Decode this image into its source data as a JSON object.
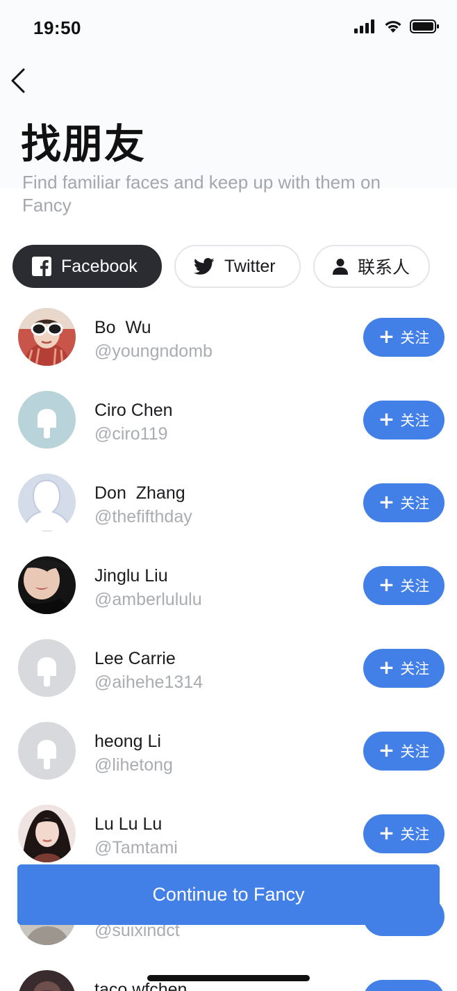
{
  "status_bar": {
    "time": "19:50"
  },
  "header": {
    "title": "找朋友",
    "subtitle": "Find familiar faces and keep up with them on Fancy"
  },
  "tabs": [
    {
      "label": "Facebook",
      "icon": "facebook-icon",
      "active": true
    },
    {
      "label": "Twitter",
      "icon": "twitter-icon",
      "active": false
    },
    {
      "label": "联系人",
      "icon": "person-icon",
      "active": false
    }
  ],
  "friends": [
    {
      "name": "Bo  Wu",
      "handle": "@youngndomb",
      "avatar": "photo",
      "follow_label": "关注"
    },
    {
      "name": "Ciro Chen",
      "handle": "@ciro119",
      "avatar": "popsicle-placeholder",
      "follow_label": "关注"
    },
    {
      "name": "Don  Zhang",
      "handle": "@thefifthday",
      "avatar": "silhouette",
      "follow_label": "关注"
    },
    {
      "name": "Jinglu Liu",
      "handle": "@amberlululu",
      "avatar": "photo",
      "follow_label": "关注"
    },
    {
      "name": "Lee Carrie",
      "handle": "@aihehe1314",
      "avatar": "popsicle-placeholder",
      "follow_label": "关注"
    },
    {
      "name": "heong Li",
      "handle": "@lihetong",
      "avatar": "popsicle-placeholder",
      "follow_label": "关注"
    },
    {
      "name": "Lu Lu Lu",
      "handle": "@Tamtami",
      "avatar": "photo",
      "follow_label": "关注"
    },
    {
      "name": "",
      "handle": "@suixindct",
      "avatar": "photo",
      "follow_label": ""
    },
    {
      "name": "taco wfchen",
      "handle": "",
      "avatar": "photo",
      "follow_label": ""
    }
  ],
  "continue_button": {
    "label": "Continue to Fancy"
  },
  "colors": {
    "accent": "#4280e8",
    "active_tab": "#2a2c31",
    "muted_text": "#a9acb1"
  }
}
